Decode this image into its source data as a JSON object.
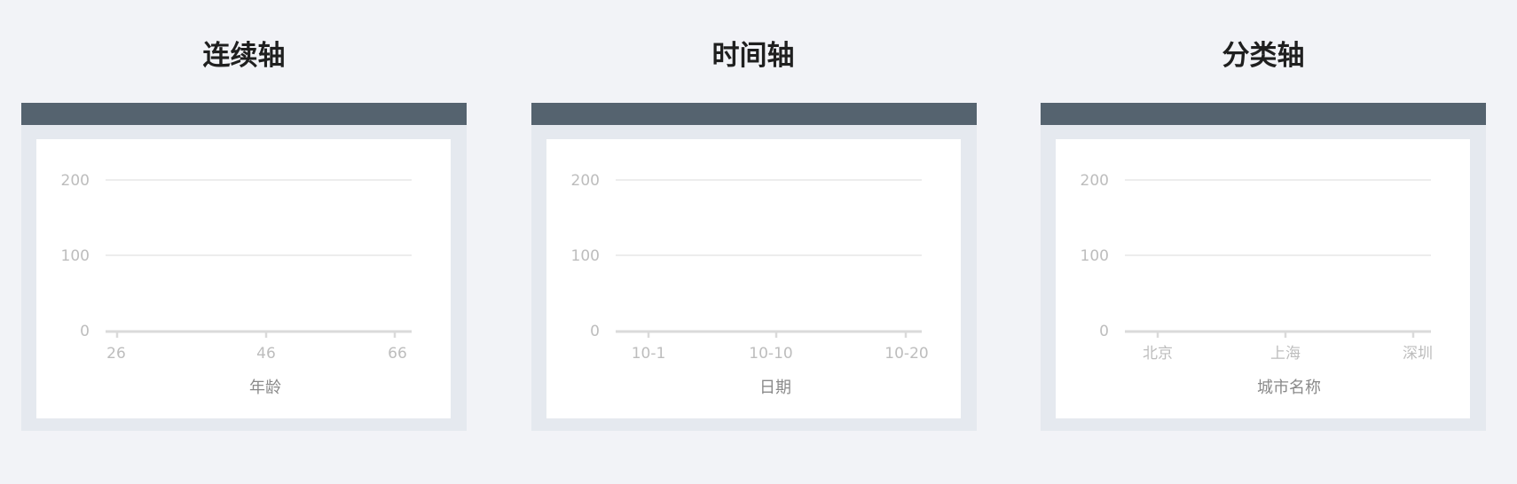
{
  "colors": {
    "background": "#f2f3f7",
    "window_frame": "#e5e9ef",
    "window_bar": "#55636f",
    "card": "#ffffff",
    "gridline": "#e2e2e2",
    "axis_line": "#dadada",
    "tick_text": "#bdbdbd",
    "axis_label_text": "#8a8a8a",
    "title_text": "#1f1f1f"
  },
  "panels": [
    {
      "title": "连续轴"
    },
    {
      "title": "时间轴"
    },
    {
      "title": "分类轴"
    }
  ],
  "chart_data": [
    {
      "type": "line",
      "title": "",
      "xlabel": "年龄",
      "ylabel": "",
      "x_axis_kind": "continuous",
      "ylim": [
        0,
        200
      ],
      "yticks": [
        "0",
        "100",
        "200"
      ],
      "xticks": [
        "26",
        "46",
        "66"
      ],
      "grid": true,
      "series": []
    },
    {
      "type": "line",
      "title": "",
      "xlabel": "日期",
      "ylabel": "",
      "x_axis_kind": "time",
      "ylim": [
        0,
        200
      ],
      "yticks": [
        "0",
        "100",
        "200"
      ],
      "xticks": [
        "10-1",
        "10-10",
        "10-20"
      ],
      "grid": true,
      "series": []
    },
    {
      "type": "line",
      "title": "",
      "xlabel": "城市名称",
      "ylabel": "",
      "x_axis_kind": "category",
      "ylim": [
        0,
        200
      ],
      "yticks": [
        "0",
        "100",
        "200"
      ],
      "xticks": [
        "北京",
        "上海",
        "深圳"
      ],
      "grid": true,
      "series": []
    }
  ]
}
